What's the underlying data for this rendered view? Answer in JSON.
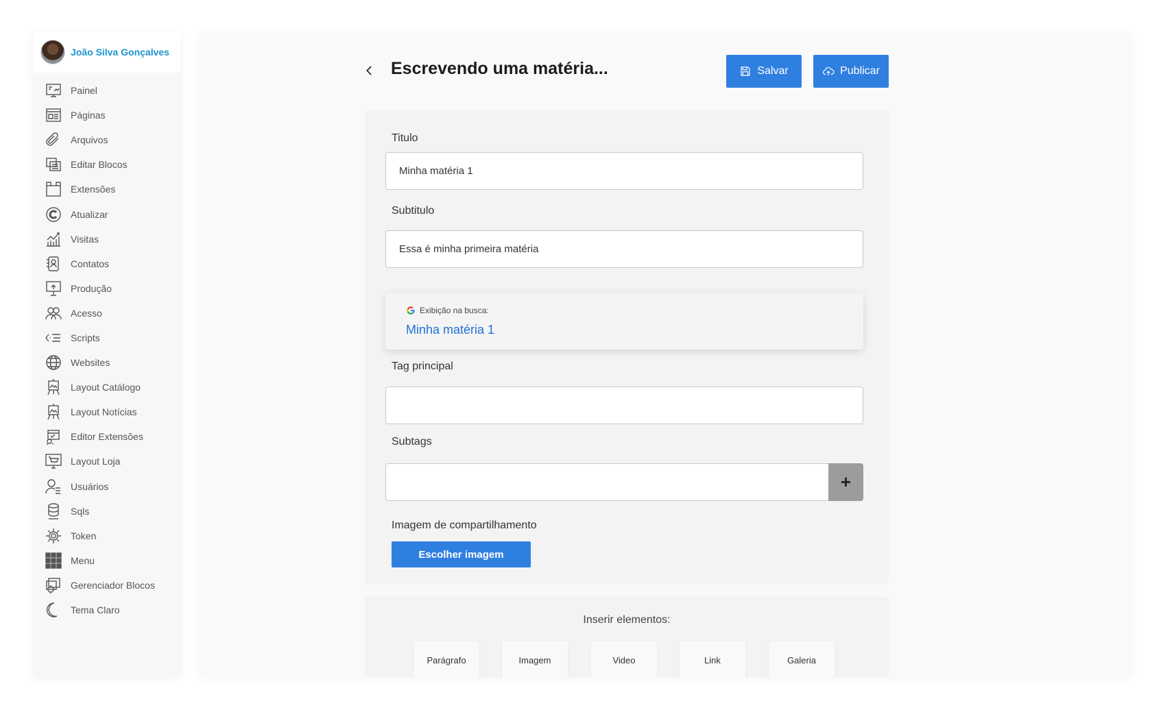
{
  "profile": {
    "name": "João Silva Gonçalves"
  },
  "sidebar": {
    "items": [
      {
        "label": "Painel",
        "icon": "dashboard-icon"
      },
      {
        "label": "Páginas",
        "icon": "pages-icon"
      },
      {
        "label": "Arquivos",
        "icon": "paperclip-icon"
      },
      {
        "label": "Editar Blocos",
        "icon": "blocks-icon"
      },
      {
        "label": "Extensões",
        "icon": "extensions-icon"
      },
      {
        "label": "Atualizar",
        "icon": "update-icon"
      },
      {
        "label": "Visitas",
        "icon": "chart-icon"
      },
      {
        "label": "Contatos",
        "icon": "contacts-icon"
      },
      {
        "label": "Produção",
        "icon": "presentation-icon"
      },
      {
        "label": "Acesso",
        "icon": "users-icon"
      },
      {
        "label": "Scripts",
        "icon": "code-icon"
      },
      {
        "label": "Websites",
        "icon": "globe-icon"
      },
      {
        "label": "Layout Catálogo",
        "icon": "easel-icon"
      },
      {
        "label": "Layout Notícias",
        "icon": "easel-icon"
      },
      {
        "label": "Editor Extensões",
        "icon": "extension-editor-icon"
      },
      {
        "label": "Layout Loja",
        "icon": "shop-icon"
      },
      {
        "label": "Usuários",
        "icon": "user-list-icon"
      },
      {
        "label": "Sqls",
        "icon": "database-icon"
      },
      {
        "label": "Token",
        "icon": "token-icon"
      },
      {
        "label": "Menu",
        "icon": "grid-icon"
      },
      {
        "label": "Gerenciador Blocos",
        "icon": "block-manager-icon"
      },
      {
        "label": "Tema Claro",
        "icon": "moon-icon"
      }
    ]
  },
  "header": {
    "title": "Escrevendo uma matéria...",
    "save_label": "Salvar",
    "publish_label": "Publicar"
  },
  "form": {
    "title_label": "Titulo",
    "title_value": "Minha matéria 1",
    "subtitle_label": "Subtitulo",
    "subtitle_value": "Essa é minha primeira matéria",
    "preview_caption": "Exibição na busca:",
    "preview_title": "Minha matéria 1",
    "tag_label": "Tag principal",
    "tag_value": "",
    "subtags_label": "Subtags",
    "subtags_value": "",
    "add_label": "+",
    "image_label": "Imagem de compartilhamento",
    "choose_image_label": "Escolher imagem"
  },
  "insert": {
    "title": "Inserir elementos:",
    "elements": [
      "Parágrafo",
      "Imagem",
      "Video",
      "Link",
      "Galeria"
    ]
  },
  "colors": {
    "accent": "#2f7fe0",
    "profile_name": "#1e93cf",
    "preview_link": "#1f6fd6"
  }
}
